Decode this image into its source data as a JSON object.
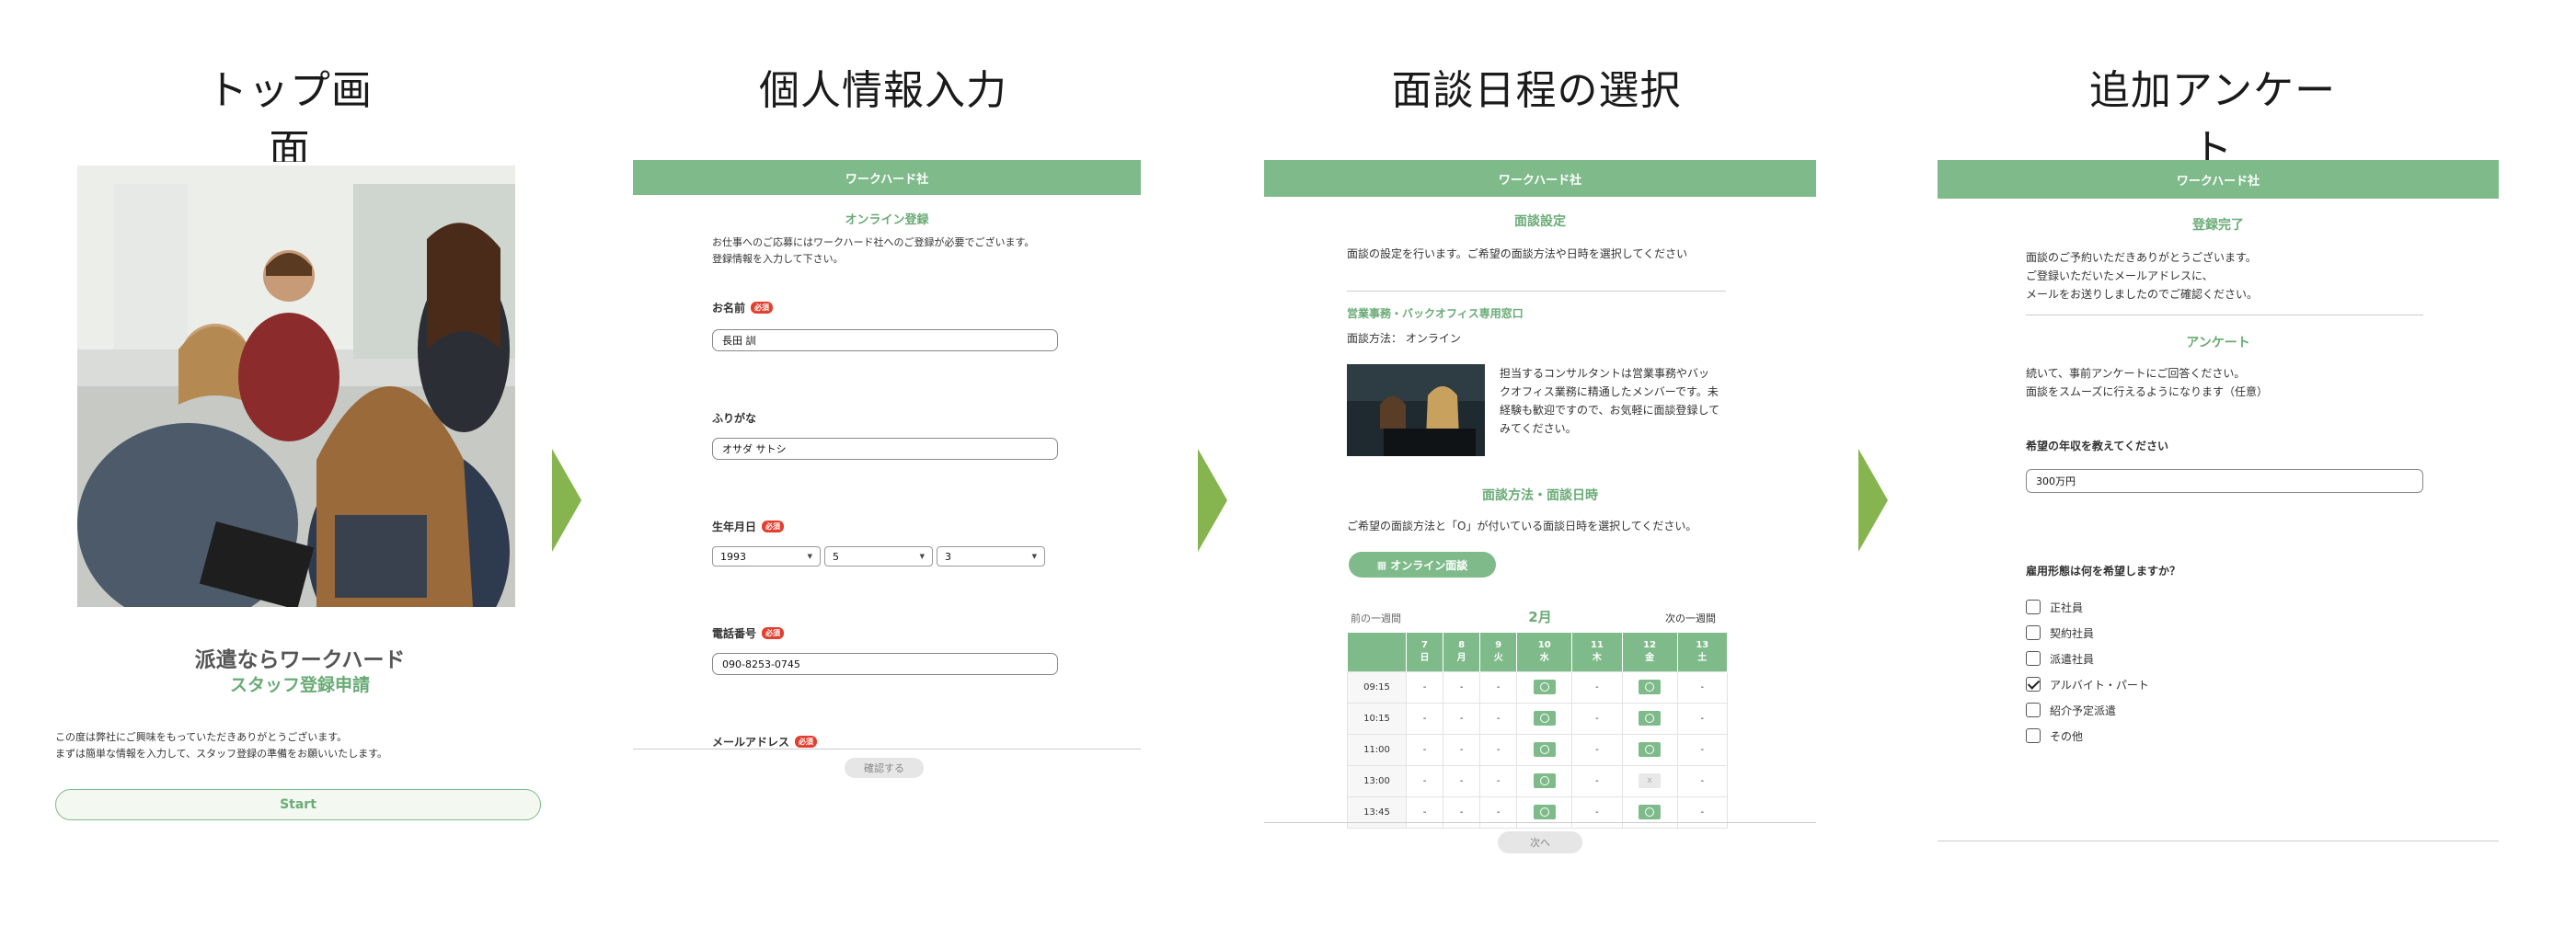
{
  "step_titles": [
    "トップ画面",
    "個人情報入力",
    "面談日程の選択",
    "追加アンケート"
  ],
  "colors": {
    "brand_green": "#7fbb8a",
    "accent_green": "#6aab76",
    "arrow_green": "#86b44e",
    "required_red": "#e2402f"
  },
  "screen1": {
    "photo_alt": "office-meeting-photo",
    "heading": "派遣ならワークハード",
    "subheading": "スタッフ登録申請",
    "intro_line1": "この度は弊社にご興味をもっていただきありがとうございます。",
    "intro_line2": "まずは簡単な情報を入力して、スタッフ登録の準備をお願いいたします。",
    "start_label": "Start"
  },
  "screen2": {
    "header": "ワークハード社",
    "section_title": "オンライン登録",
    "intro_line1": "お仕事へのご応募にはワークハード社へのご登録が必要でございます。",
    "intro_line2": "登録情報を入力して下さい。",
    "name_label": "お名前",
    "name_value": "長田 訓",
    "kana_label": "ふりがな",
    "kana_value": "オサダ サトシ",
    "birth_label": "生年月日",
    "birth_year": "1993",
    "birth_month": "5",
    "birth_day": "3",
    "phone_label": "電話番号",
    "phone_value": "090-8253-0745",
    "email_label": "メールアドレス",
    "required_badge": "必須",
    "confirm_label": "確認する"
  },
  "screen3": {
    "header": "ワークハード社",
    "section_title": "面談設定",
    "intro": "面談の設定を行います。ご希望の面談方法や日時を選択してください",
    "office_name": "営業事務・バックオフィス専用窓口",
    "method_line": "面談方法： オンライン",
    "consultant_text_1": "担当するコンサルタントは営業事務やバッ",
    "consultant_text_2": "クオフィス業務に精通したメンバーです。未",
    "consultant_text_3": "経験も歓迎ですので、お気軽に面談登録して",
    "consultant_text_4": "みてください。",
    "section2_title": "面談方法・面談日時",
    "instruction": "ご希望の面談方法と「O」が付いている面談日時を選択してください。",
    "online_button": "オンライン面談",
    "prev_week": "前の一週間",
    "month": "2月",
    "next_week": "次の一週間",
    "days": [
      {
        "date": "7",
        "dow": "日"
      },
      {
        "date": "8",
        "dow": "月"
      },
      {
        "date": "9",
        "dow": "火"
      },
      {
        "date": "10",
        "dow": "水"
      },
      {
        "date": "11",
        "dow": "木"
      },
      {
        "date": "12",
        "dow": "金"
      },
      {
        "date": "13",
        "dow": "土"
      }
    ],
    "rows": [
      {
        "time": "09:15",
        "cells": [
          "-",
          "-",
          "-",
          "O",
          "-",
          "O",
          "-"
        ]
      },
      {
        "time": "10:15",
        "cells": [
          "-",
          "-",
          "-",
          "O",
          "-",
          "O",
          "-"
        ]
      },
      {
        "time": "11:00",
        "cells": [
          "-",
          "-",
          "-",
          "O",
          "-",
          "O",
          "-"
        ]
      },
      {
        "time": "13:00",
        "cells": [
          "-",
          "-",
          "-",
          "O",
          "-",
          "x",
          "-"
        ]
      },
      {
        "time": "13:45",
        "cells": [
          "-",
          "-",
          "-",
          "O",
          "-",
          "O",
          "-"
        ]
      }
    ],
    "next_label": "次へ"
  },
  "screen4": {
    "header": "ワークハード社",
    "done_title": "登録完了",
    "done_line1": "面談のご予約いただきありがとうございます。",
    "done_line2": "ご登録いただいたメールアドレスに、",
    "done_line3": "メールをお送りしましたのでご確認ください。",
    "survey_title": "アンケート",
    "survey_line1": "続いて、事前アンケートにご回答ください。",
    "survey_line2": "面談をスムーズに行えるようになります（任意）",
    "income_label": "希望の年収を教えてください",
    "income_value": "300万円",
    "employment_label": "雇用形態は何を希望しますか？",
    "options": [
      {
        "label": "正社員",
        "checked": false
      },
      {
        "label": "契約社員",
        "checked": false
      },
      {
        "label": "派遣社員",
        "checked": false
      },
      {
        "label": "アルバイト・パート",
        "checked": true
      },
      {
        "label": "紹介予定派遣",
        "checked": false
      },
      {
        "label": "その他",
        "checked": false
      }
    ]
  }
}
